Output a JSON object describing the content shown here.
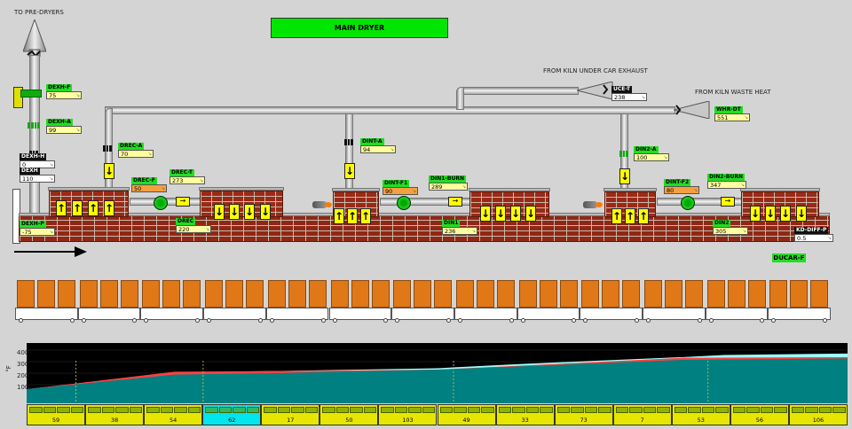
{
  "title": "MAIN DRYER",
  "labels": {
    "to_predryers": "TO PRE-DRYERS",
    "from_under_car": "FROM KILN UNDER CAR EXHAUST",
    "from_waste_heat": "FROM KILN WASTE HEAT"
  },
  "tags": {
    "dexh_f": {
      "name": "DEXH-F",
      "value": "75"
    },
    "dexh_a": {
      "name": "DEXH-A",
      "value": "99"
    },
    "dexh_h": {
      "name": "DEXH-H",
      "value": "0"
    },
    "dexh": {
      "name": "DEXH",
      "value": "110"
    },
    "dexh_p": {
      "name": "DEXH-P",
      "value": "-75"
    },
    "drec_a": {
      "name": "DREC-A",
      "value": "70"
    },
    "drec_f": {
      "name": "DREC-F",
      "value": "50"
    },
    "drec_t": {
      "name": "DREC-T",
      "value": "273"
    },
    "drec": {
      "name": "DREC",
      "value": "220"
    },
    "dint_a": {
      "name": "DINT-A",
      "value": "94"
    },
    "dint_f1": {
      "name": "DINT-F1",
      "value": "90"
    },
    "din1_burn": {
      "name": "DIN1-BURN",
      "value": "289"
    },
    "din1": {
      "name": "DIN1",
      "value": "236"
    },
    "uce_t": {
      "name": "UCE-T",
      "value": "238"
    },
    "whr_dt": {
      "name": "WHR-DT",
      "value": "551"
    },
    "din2_a": {
      "name": "DIN2-A",
      "value": "100"
    },
    "dint_f2": {
      "name": "DINT-F2",
      "value": "80"
    },
    "din2_burn": {
      "name": "DIN2-BURN",
      "value": "347"
    },
    "din2": {
      "name": "DIN2",
      "value": "305"
    },
    "kd_diff_p": {
      "name": "KD-DIFF-P",
      "value": "0.5"
    }
  },
  "ducar_button": "DUCAR-F",
  "trend": {
    "y_unit": "°F",
    "y_ticks": [
      "400",
      "300",
      "200",
      "100"
    ],
    "colors": {
      "background": "#000000",
      "fill_main": "#008080",
      "fill_high": "#ff4040",
      "fill_top": "#a0ffff",
      "grid": "#808000"
    }
  },
  "zones": [
    {
      "label": "59",
      "selected": false
    },
    {
      "label": "38",
      "selected": false
    },
    {
      "label": "54",
      "selected": false
    },
    {
      "label": "62",
      "selected": true
    },
    {
      "label": "17",
      "selected": false
    },
    {
      "label": "50",
      "selected": false
    },
    {
      "label": "103",
      "selected": false
    },
    {
      "label": "49",
      "selected": false
    },
    {
      "label": "33",
      "selected": false
    },
    {
      "label": "73",
      "selected": false
    },
    {
      "label": "7",
      "selected": false
    },
    {
      "label": "53",
      "selected": false
    },
    {
      "label": "56",
      "selected": false
    },
    {
      "label": "106",
      "selected": false
    }
  ],
  "colors": {
    "accent_green": "#00e600",
    "value_yellow": "#ffffa0",
    "value_orange": "#f5a040",
    "brick": "#9a2a18",
    "ware": "#e07818"
  }
}
